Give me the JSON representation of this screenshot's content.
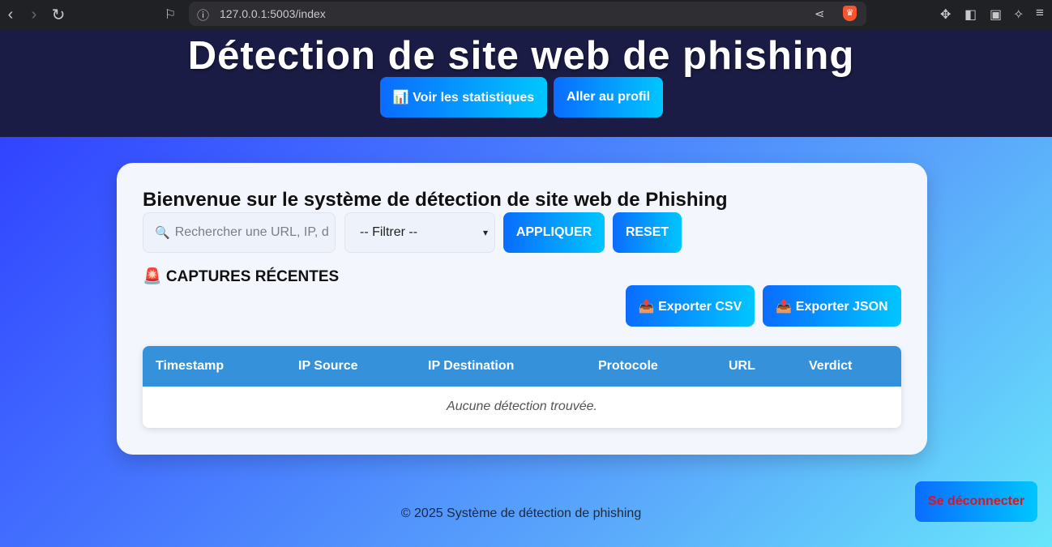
{
  "browser": {
    "url": "127.0.0.1:5003/index"
  },
  "header": {
    "title": "Détection de site web de phishing",
    "stats_button": "📊 Voir les statistiques",
    "profile_button": "Aller au profil"
  },
  "main": {
    "welcome": "Bienvenue sur le système de détection de site web de Phishing",
    "search_placeholder": "Rechercher une URL, IP, d",
    "filter_selected": "-- Filtrer --",
    "apply_button": "APPLIQUER",
    "reset_button": "RESET",
    "section_title": "🚨 CAPTURES RÉCENTES",
    "export_csv": "📤 Exporter CSV",
    "export_json": "📤 Exporter JSON",
    "table": {
      "columns": [
        "Timestamp",
        "IP Source",
        "IP Destination",
        "Protocole",
        "URL",
        "Verdict"
      ],
      "empty_message": "Aucune détection trouvée."
    }
  },
  "footer": {
    "text": "© 2025 Système de détection de phishing"
  },
  "logout_button": "Se déconnecter",
  "colors": {
    "header_bg": "#1b1c45",
    "button_gradient_start": "#0a6cff",
    "button_gradient_end": "#00c6ff",
    "table_header": "#3592da",
    "logout_text": "#e0121e"
  }
}
